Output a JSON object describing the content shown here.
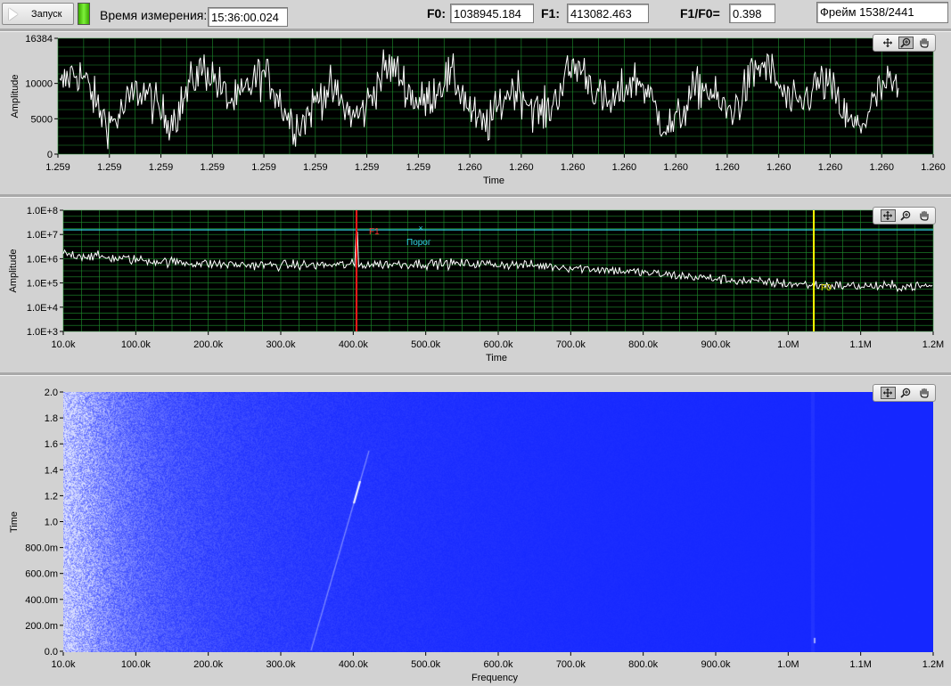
{
  "toolbar": {
    "run_label": "Запуск",
    "measure_time_label": "Время измерения:",
    "measure_time_value": "15:36:00.024",
    "f0_label": "F0:",
    "f0_value": "1038945.184",
    "f1_label": "F1:",
    "f1_value": "413082.463",
    "ratio_label": "F1/F0=",
    "ratio_value": "0.398",
    "frame_value": "Фрейм 1538/2441"
  },
  "graph_time": {
    "ylabel": "Amplitude",
    "xlabel": "Time",
    "y_ticks": [
      "16384",
      "10000",
      "5000",
      "0"
    ],
    "x_ticks": [
      "1.259",
      "1.259",
      "1.259",
      "1.259",
      "1.259",
      "1.259",
      "1.259",
      "1.259",
      "1.260",
      "1.260",
      "1.260",
      "1.260",
      "1.260",
      "1.260",
      "1.260",
      "1.260",
      "1.260",
      "1.260"
    ],
    "tools": [
      "cursor-move-icon",
      "zoom-icon",
      "pan-hand-icon"
    ]
  },
  "graph_spectrum": {
    "ylabel": "Amplitude",
    "xlabel": "Time",
    "y_ticks": [
      "1.0E+8",
      "1.0E+7",
      "1.0E+6",
      "1.0E+5",
      "1.0E+4",
      "1.0E+3"
    ],
    "x_ticks": [
      "10.0k",
      "100.0k",
      "200.0k",
      "300.0k",
      "400.0k",
      "500.0k",
      "600.0k",
      "700.0k",
      "800.0k",
      "900.0k",
      "1.0M",
      "1.1M",
      "1.2M"
    ],
    "cursor_f1_label": "F1",
    "cursor_threshold_label": "Порог",
    "cursor_f0_label": "F0",
    "colors": {
      "f1": "#ff1a1a",
      "f0": "#ffff00",
      "threshold": "#33d6e6",
      "trace": "#ffffff",
      "grid": "#1f8f2e"
    },
    "tools": [
      "cursor-move-icon",
      "zoom-icon",
      "pan-hand-icon"
    ]
  },
  "graph_spectrogram": {
    "ylabel": "Time",
    "xlabel": "Frequency",
    "y_ticks": [
      "2.0",
      "1.8",
      "1.6",
      "1.4",
      "1.2",
      "1.0",
      "800.0m",
      "600.0m",
      "400.0m",
      "200.0m",
      "0.0"
    ],
    "x_ticks": [
      "10.0k",
      "100.0k",
      "200.0k",
      "300.0k",
      "400.0k",
      "500.0k",
      "600.0k",
      "700.0k",
      "800.0k",
      "900.0k",
      "1.0M",
      "1.1M",
      "1.2M"
    ],
    "colors": {
      "background": "#1426ff",
      "low_freq_noise": "#9aa8ff",
      "streak": "#ffffff"
    },
    "tools": [
      "cursor-move-icon",
      "zoom-icon",
      "pan-hand-icon"
    ]
  }
}
